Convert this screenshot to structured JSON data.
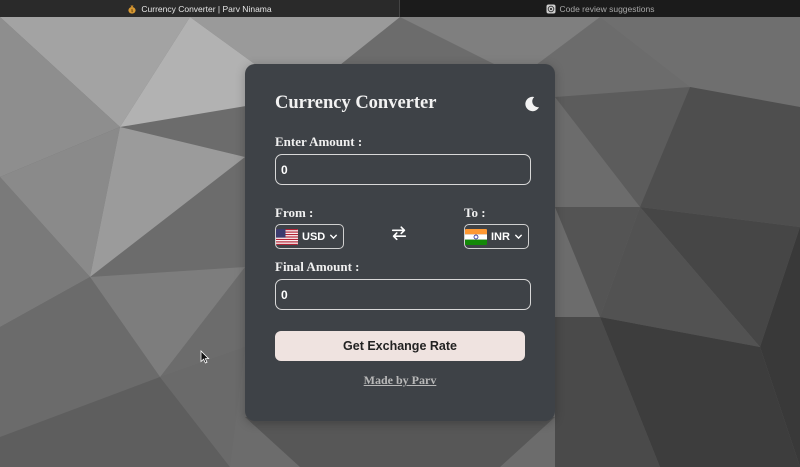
{
  "browser": {
    "tabs": [
      {
        "label": "Currency Converter | Parv Ninama",
        "active": true,
        "icon": "money-bag-icon"
      },
      {
        "label": "Code review suggestions",
        "active": false,
        "icon": "openai-icon"
      }
    ]
  },
  "card": {
    "title": "Currency Converter",
    "theme_toggle_icon": "moon-icon",
    "amount": {
      "label": "Enter Amount :",
      "value": "0"
    },
    "from": {
      "label": "From :",
      "currency": "USD",
      "flag": "us-flag-icon"
    },
    "swap_icon": "swap-arrows-icon",
    "to": {
      "label": "To :",
      "currency": "INR",
      "flag": "india-flag-icon"
    },
    "final": {
      "label": "Final Amount :",
      "value": "0"
    },
    "button_label": "Get Exchange Rate",
    "footer": "Made by Parv"
  },
  "colors": {
    "card_bg": "#3e4247",
    "button_bg": "#efe3e0",
    "tab_bar": "#1e1e1e"
  }
}
